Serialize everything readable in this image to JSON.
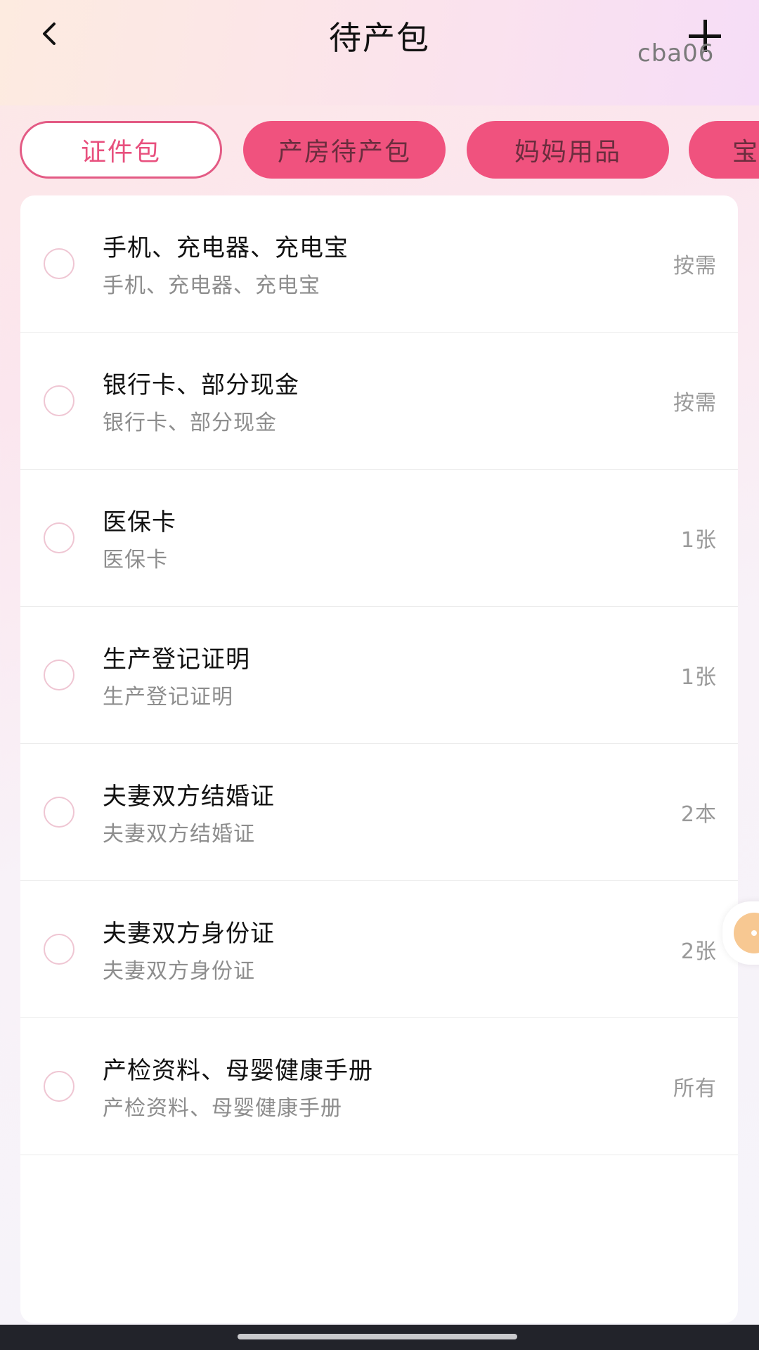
{
  "header": {
    "title": "待产包",
    "watermark": "cba06"
  },
  "tabs": [
    {
      "label": "证件包",
      "active": true
    },
    {
      "label": "产房待产包",
      "active": false
    },
    {
      "label": "妈妈用品",
      "active": false
    },
    {
      "label": "宝",
      "active": false
    }
  ],
  "items": [
    {
      "name": "手机、充电器、充电宝",
      "desc": "手机、充电器、充电宝",
      "qty": "按需"
    },
    {
      "name": "银行卡、部分现金",
      "desc": "银行卡、部分现金",
      "qty": "按需"
    },
    {
      "name": "医保卡",
      "desc": "医保卡",
      "qty": "1张"
    },
    {
      "name": "生产登记证明",
      "desc": "生产登记证明",
      "qty": "1张"
    },
    {
      "name": "夫妻双方结婚证",
      "desc": "夫妻双方结婚证",
      "qty": "2本"
    },
    {
      "name": "夫妻双方身份证",
      "desc": "夫妻双方身份证",
      "qty": "2张"
    },
    {
      "name": "产检资料、母婴健康手册",
      "desc": "产检资料、母婴健康手册",
      "qty": "所有"
    }
  ],
  "icons": {
    "back": "chevron-left-icon",
    "add": "plus-icon",
    "item_check": "circle-checkbox-icon"
  },
  "colors": {
    "accent": "#f0527e",
    "active_tab_text": "#e8507e",
    "active_tab_border": "#e35a84",
    "checkbox_border": "#efc6d3",
    "float_button": "#f7c892",
    "nav_bar": "#22232a"
  }
}
